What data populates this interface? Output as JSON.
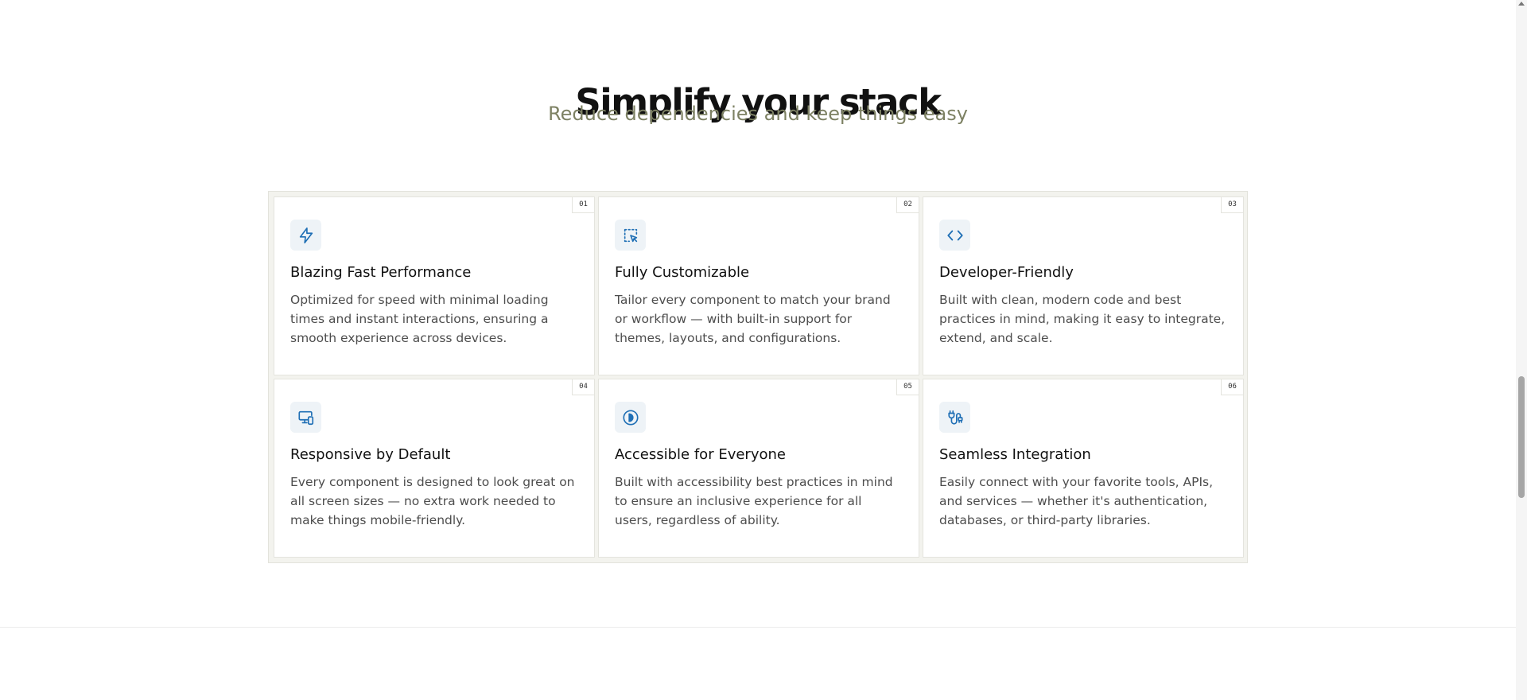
{
  "section": {
    "title": "Simplify your stack",
    "subtitle": "Reduce dependencies and keep things easy"
  },
  "features": [
    {
      "number": "01",
      "icon": "lightning-icon",
      "title": "Blazing Fast Performance",
      "description": "Optimized for speed with minimal loading times and instant interactions, ensuring a smooth experience across devices."
    },
    {
      "number": "02",
      "icon": "selection-pointer-icon",
      "title": "Fully Customizable",
      "description": "Tailor every component to match your brand or workflow — with built-in support for themes, layouts, and configurations."
    },
    {
      "number": "03",
      "icon": "code-icon",
      "title": "Developer-Friendly",
      "description": "Built with clean, modern code and best practices in mind, making it easy to integrate, extend, and scale."
    },
    {
      "number": "04",
      "icon": "devices-icon",
      "title": "Responsive by Default",
      "description": "Every component is designed to look great on all screen sizes — no extra work needed to make things mobile-friendly."
    },
    {
      "number": "05",
      "icon": "accessibility-icon",
      "title": "Accessible for Everyone",
      "description": "Built with accessibility best practices in mind to ensure an inclusive experience for all users, regardless of ability."
    },
    {
      "number": "06",
      "icon": "plug-icon",
      "title": "Seamless Integration",
      "description": "Easily connect with your favorite tools, APIs, and services — whether it's authentication, databases, or third-party libraries."
    }
  ],
  "colors": {
    "icon_accent": "#1f6fb5",
    "icon_background": "#eef3f7",
    "subtitle": "#7d8163",
    "grid_background": "#f3f3ee"
  }
}
